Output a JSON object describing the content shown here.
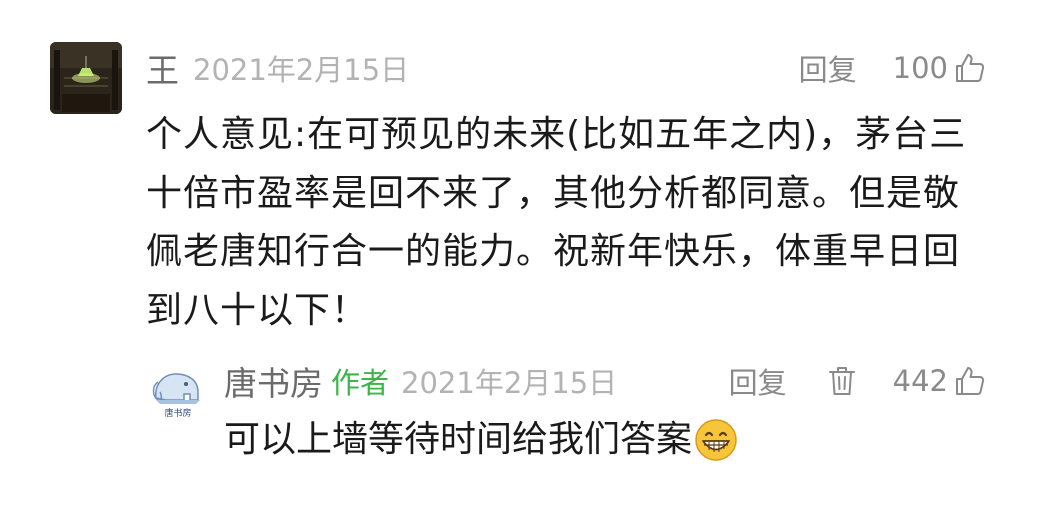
{
  "comment": {
    "username": "王",
    "date": "2021年2月15日",
    "reply_label": "回复",
    "like_count": "100",
    "text": "个人意见:在可预见的未来(比如五年之内)，茅台三十倍市盈率是回不来了，其他分析都同意。但是敬佩老唐知行合一的能力。祝新年快乐，体重早日回到八十以下！"
  },
  "reply": {
    "username": "唐书房",
    "author_tag": "作者",
    "date": "2021年2月15日",
    "reply_label": "回复",
    "like_count": "442",
    "text": "可以上墙等待时间给我们答案",
    "avatar_caption": "唐书房",
    "emoji": "grinning-face"
  },
  "colors": {
    "username": "#6b6b6b",
    "date": "#b3b3b3",
    "author_tag": "#3bb54a",
    "action": "#8a8a8a",
    "body_text": "#1a1a1a"
  }
}
